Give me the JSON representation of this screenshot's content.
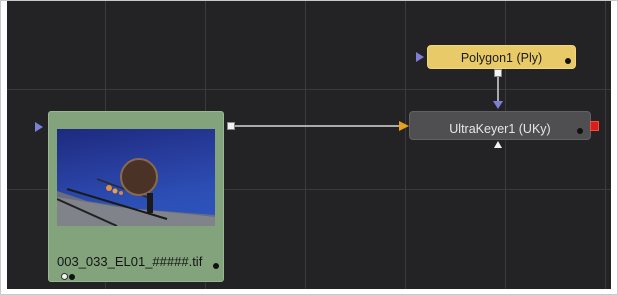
{
  "nodes": {
    "loader": {
      "label": "003_033_EL01_#####.tif"
    },
    "polygon": {
      "label": "Polygon1  (Ply)"
    },
    "keyer": {
      "label": "UltraKeyer1  (UKy)"
    }
  },
  "colors": {
    "canvas": "#232325",
    "grid": "#3a3a3c",
    "loader_node": "#83a37c",
    "polygon_node": "#e8cb68",
    "keyer_node": "#4f4f52",
    "input_triangle": "#7b7fd6",
    "foreground_input": "#e6a020",
    "output_red": "#d3201d"
  },
  "icons": [
    "input-triangle-icon",
    "output-square-icon",
    "mask-input-triangle-icon",
    "view-indicator-dot-icon"
  ]
}
